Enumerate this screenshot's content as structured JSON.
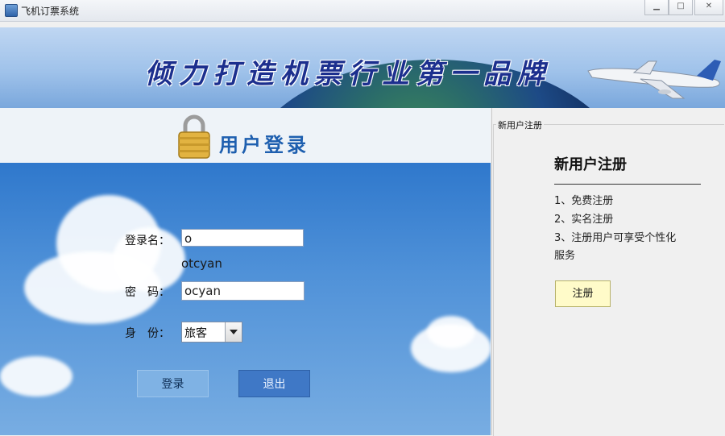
{
  "window": {
    "title": "飞机订票系统",
    "controls": [
      "minimize",
      "maximize",
      "close"
    ]
  },
  "banner": {
    "slogan": "倾力打造机票行业第一品牌"
  },
  "login": {
    "title": "用户登录",
    "username_label": "登录名：",
    "username_value": "o",
    "username_hint": "otcyan",
    "password_label": "密　码：",
    "password_value": "ocyan",
    "role_label": "身　份：",
    "role_value": "旅客",
    "login_button": "登录",
    "exit_button": "退出"
  },
  "register": {
    "group_label": "新用户注册",
    "title": "新用户注册",
    "items": [
      "1、免费注册",
      "2、实名注册",
      "3、注册用户可享受个性化",
      "服务"
    ],
    "button": "注册"
  },
  "colors": {
    "banner_text": "#1c2f8e",
    "login_title": "#1e5faf",
    "sky": "#4f91d8",
    "register_button": "#fffbc9"
  }
}
